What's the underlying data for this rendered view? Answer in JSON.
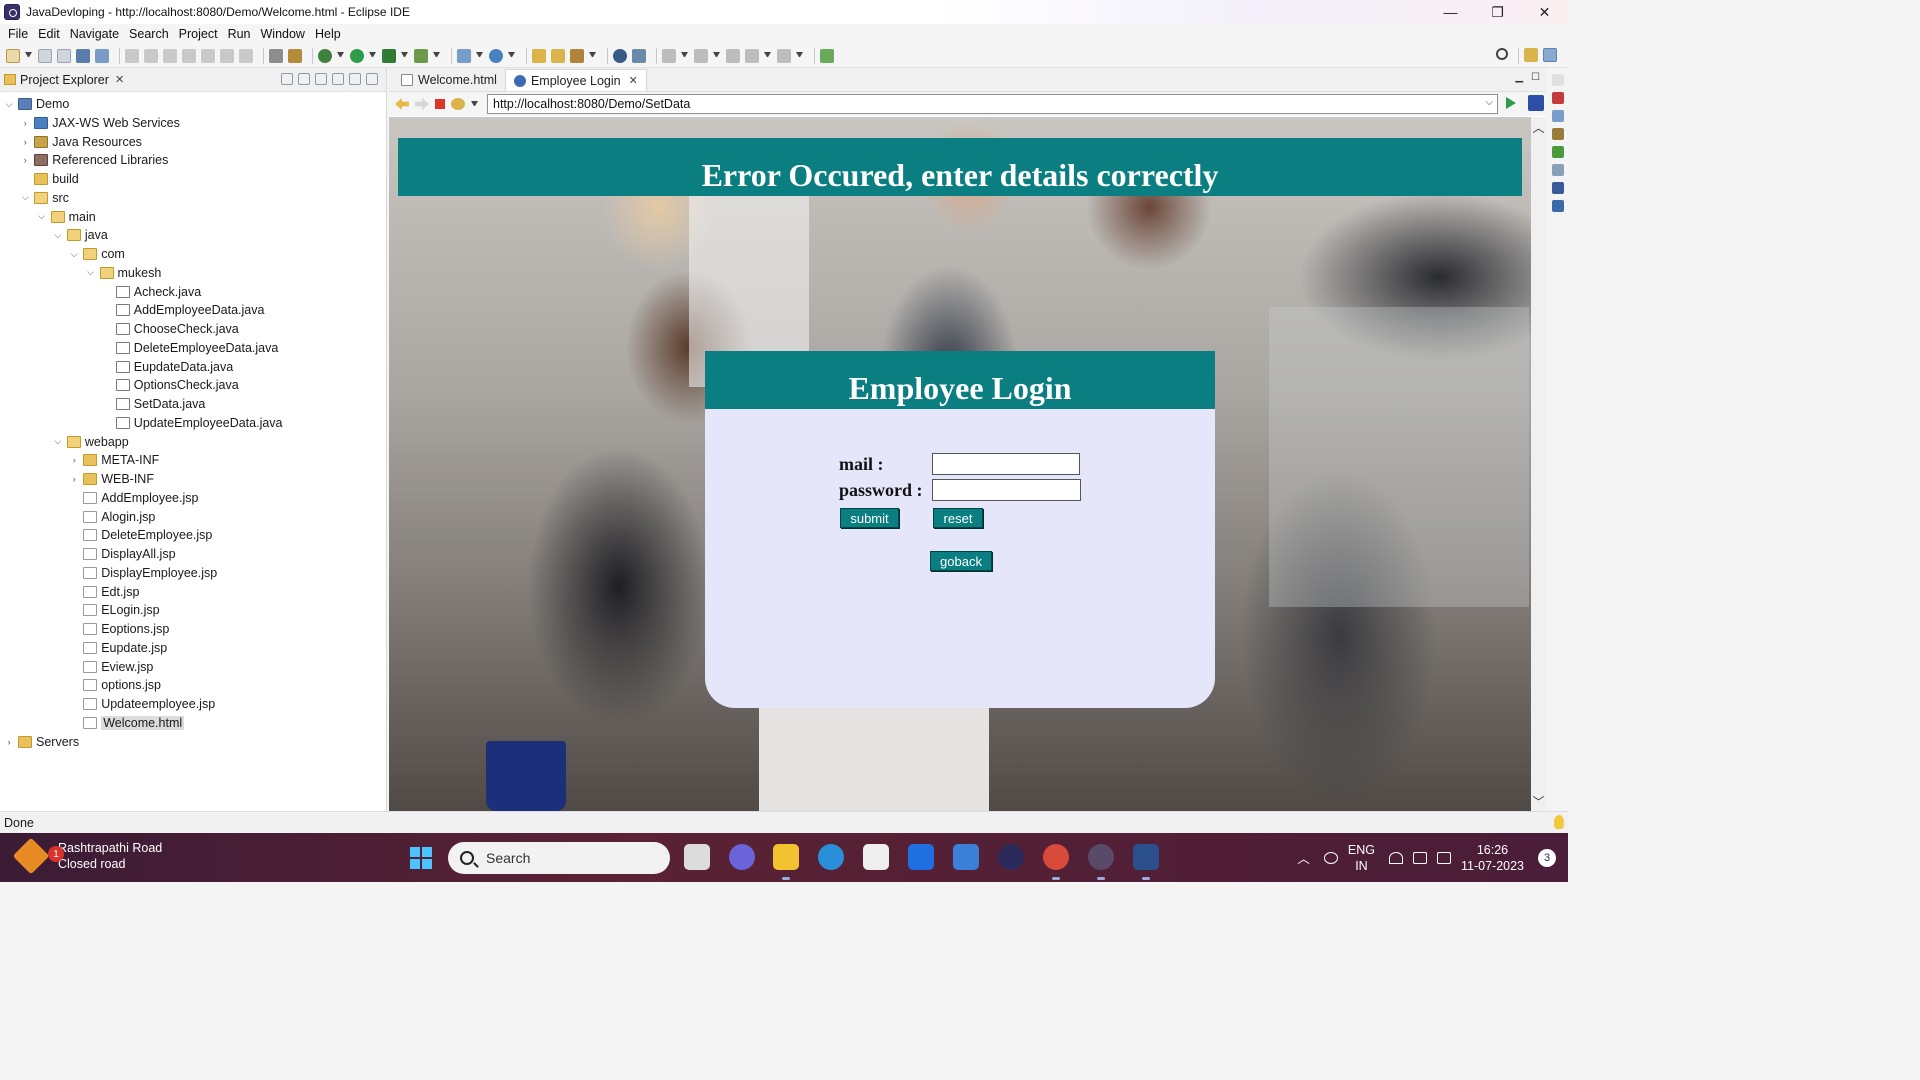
{
  "window": {
    "title": "JavaDevloping - http://localhost:8080/Demo/Welcome.html - Eclipse IDE",
    "controls": {
      "minimize": "—",
      "restore": "❐",
      "close": "✕"
    }
  },
  "menubar": [
    "File",
    "Edit",
    "Navigate",
    "Search",
    "Project",
    "Run",
    "Window",
    "Help"
  ],
  "explorer": {
    "title": "Project Explorer",
    "tree": [
      {
        "label": "Demo",
        "depth": 0,
        "expanded": true,
        "icon": "project"
      },
      {
        "label": "JAX-WS Web Services",
        "depth": 1,
        "expanded": false,
        "icon": "ws"
      },
      {
        "label": "Java Resources",
        "depth": 1,
        "expanded": false,
        "icon": "res"
      },
      {
        "label": "Referenced Libraries",
        "depth": 1,
        "expanded": false,
        "icon": "lib"
      },
      {
        "label": "build",
        "depth": 1,
        "expanded": null,
        "icon": "folder"
      },
      {
        "label": "src",
        "depth": 1,
        "expanded": true,
        "icon": "folder-open"
      },
      {
        "label": "main",
        "depth": 2,
        "expanded": true,
        "icon": "folder-open"
      },
      {
        "label": "java",
        "depth": 3,
        "expanded": true,
        "icon": "folder-open"
      },
      {
        "label": "com",
        "depth": 4,
        "expanded": true,
        "icon": "folder-open"
      },
      {
        "label": "mukesh",
        "depth": 5,
        "expanded": true,
        "icon": "folder-open"
      },
      {
        "label": "Acheck.java",
        "depth": 6,
        "expanded": null,
        "icon": "java"
      },
      {
        "label": "AddEmployeeData.java",
        "depth": 6,
        "expanded": null,
        "icon": "java"
      },
      {
        "label": "ChooseCheck.java",
        "depth": 6,
        "expanded": null,
        "icon": "java"
      },
      {
        "label": "DeleteEmployeeData.java",
        "depth": 6,
        "expanded": null,
        "icon": "java"
      },
      {
        "label": "EupdateData.java",
        "depth": 6,
        "expanded": null,
        "icon": "java"
      },
      {
        "label": "OptionsCheck.java",
        "depth": 6,
        "expanded": null,
        "icon": "java"
      },
      {
        "label": "SetData.java",
        "depth": 6,
        "expanded": null,
        "icon": "java"
      },
      {
        "label": "UpdateEmployeeData.java",
        "depth": 6,
        "expanded": null,
        "icon": "java"
      },
      {
        "label": "webapp",
        "depth": 3,
        "expanded": true,
        "icon": "folder-open"
      },
      {
        "label": "META-INF",
        "depth": 4,
        "expanded": false,
        "icon": "folder"
      },
      {
        "label": "WEB-INF",
        "depth": 4,
        "expanded": false,
        "icon": "folder"
      },
      {
        "label": "AddEmployee.jsp",
        "depth": 4,
        "expanded": null,
        "icon": "jsp"
      },
      {
        "label": "Alogin.jsp",
        "depth": 4,
        "expanded": null,
        "icon": "jsp"
      },
      {
        "label": "DeleteEmployee.jsp",
        "depth": 4,
        "expanded": null,
        "icon": "jsp"
      },
      {
        "label": "DisplayAll.jsp",
        "depth": 4,
        "expanded": null,
        "icon": "jsp"
      },
      {
        "label": "DisplayEmployee.jsp",
        "depth": 4,
        "expanded": null,
        "icon": "jsp"
      },
      {
        "label": "Edt.jsp",
        "depth": 4,
        "expanded": null,
        "icon": "jsp"
      },
      {
        "label": "ELogin.jsp",
        "depth": 4,
        "expanded": null,
        "icon": "jsp"
      },
      {
        "label": "Eoptions.jsp",
        "depth": 4,
        "expanded": null,
        "icon": "jsp"
      },
      {
        "label": "Eupdate.jsp",
        "depth": 4,
        "expanded": null,
        "icon": "jsp"
      },
      {
        "label": "Eview.jsp",
        "depth": 4,
        "expanded": null,
        "icon": "jsp"
      },
      {
        "label": "options.jsp",
        "depth": 4,
        "expanded": null,
        "icon": "jsp"
      },
      {
        "label": "Updateemployee.jsp",
        "depth": 4,
        "expanded": null,
        "icon": "jsp"
      },
      {
        "label": "Welcome.html",
        "depth": 4,
        "expanded": null,
        "icon": "jsp",
        "selected": true
      },
      {
        "label": "Servers",
        "depth": 0,
        "expanded": false,
        "icon": "folder"
      }
    ]
  },
  "editor": {
    "tabs": [
      {
        "label": "Welcome.html",
        "active": false
      },
      {
        "label": "Employee Login",
        "active": true
      }
    ],
    "url": "http://localhost:8080/Demo/SetData"
  },
  "webpage": {
    "error_banner": "Error Occured, enter details correctly",
    "login": {
      "heading": "Employee Login",
      "mail_label": "mail :",
      "password_label": "password :",
      "mail_value": "",
      "password_value": "",
      "submit_label": "submit",
      "reset_label": "reset",
      "goback_label": "goback"
    }
  },
  "statusbar": {
    "text": "Done"
  },
  "taskbar": {
    "weather_badge": "1",
    "weather_line1": "Rashtrapathi Road",
    "weather_line2": "Closed road",
    "search_placeholder": "Search",
    "lang_line1": "ENG",
    "lang_line2": "IN",
    "time": "16:26",
    "date": "11-07-2023",
    "notifications": "3"
  },
  "colors": {
    "teal": "#0a7e80",
    "lavender": "#e6e6fa"
  }
}
